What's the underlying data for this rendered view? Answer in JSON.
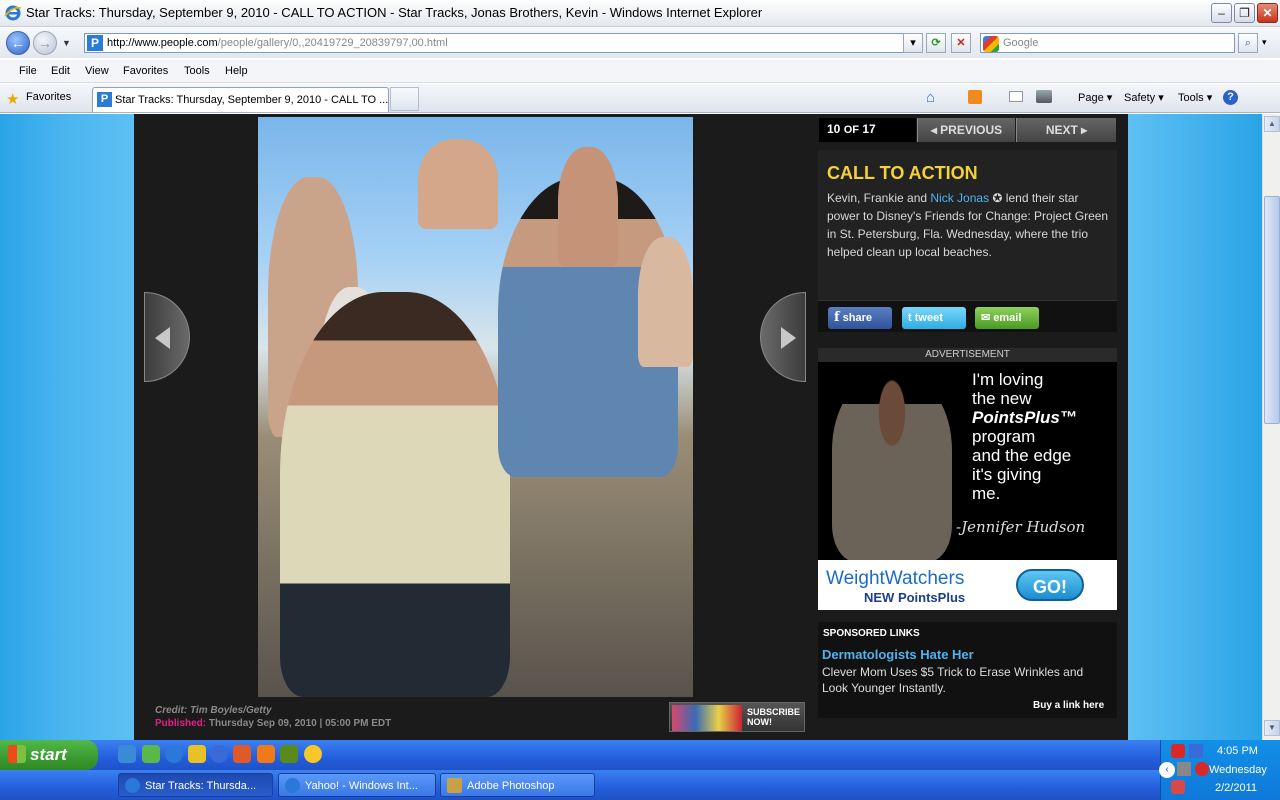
{
  "window": {
    "title": "Star Tracks: Thursday, September 9, 2010 - CALL TO ACTION - Star Tracks, Jonas Brothers, Kevin  - Windows Internet Explorer",
    "min_label": "–",
    "max_label": "❐",
    "close_label": "✕"
  },
  "address": {
    "url_host": "http://www.people.com",
    "url_path": "/people/gallery/0,,20419729_20839797,00.html"
  },
  "search": {
    "placeholder": "Google"
  },
  "menu": [
    "File",
    "Edit",
    "View",
    "Favorites",
    "Tools",
    "Help"
  ],
  "favorites": {
    "label": "Favorites"
  },
  "tab": {
    "title": "Star Tracks: Thursday, September 9, 2010 - CALL TO ..."
  },
  "commands": {
    "page": "Page ▾",
    "safety": "Safety ▾",
    "tools": "Tools ▾"
  },
  "gallery": {
    "counter_current": "10",
    "counter_of": "OF",
    "counter_total": "17",
    "prev_label": "◂ PREVIOUS",
    "next_label": "NEXT ▸",
    "caption_title": "CALL TO ACTION",
    "caption_pre": "Kevin, Frankie and ",
    "caption_link": "Nick Jonas",
    "caption_post": " ✪ lend their star power to Disney's Friends for Change: Project Green in St. Petersburg, Fla. Wednesday, where the trio helped clean up local beaches.",
    "share_label": "share",
    "tweet_label": "tweet",
    "email_label": "email",
    "credit": "Credit: Tim Boyles/Getty",
    "published_label": "Published:",
    "published_value": "Thursday Sep 09, 2010 | 05:00 PM EDT",
    "subscribe_label": "SUBSCRIBE NOW!"
  },
  "ad": {
    "label": "ADVERTISEMENT",
    "line1": "I'm loving",
    "line2": "the new",
    "line3": "PointsPlus™",
    "line4": "program",
    "line5": "and the edge",
    "line6": "it's giving",
    "line7": "me.",
    "signature": "-Jennifer Hudson",
    "brand": "WeightWatchers",
    "brand_sub": "NEW PointsPlus",
    "go": "GO!"
  },
  "sponsored": {
    "header": "SPONSORED LINKS",
    "link": "Dermatologists Hate Her",
    "desc": "Clever Mom Uses $5 Trick to Erase Wrinkles and Look Younger Instantly.",
    "buy": "Buy a link here"
  },
  "taskbar": {
    "start": "start",
    "tasks": [
      "Star Tracks: Thursda...",
      "Yahoo! - Windows Int...",
      "Adobe Photoshop"
    ],
    "time": "4:05 PM",
    "day": "Wednesday",
    "date": "2/2/2011"
  },
  "colors": {
    "accent_yellow": "#f3d23a",
    "link_blue": "#4fb3f0",
    "pink": "#e0208a"
  }
}
